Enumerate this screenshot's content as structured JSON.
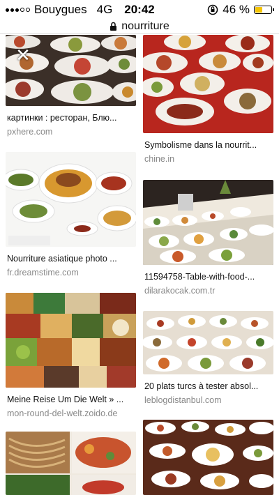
{
  "status": {
    "carrier": "Bouygues",
    "network": "4G",
    "time": "20:42",
    "battery": "46 %",
    "battery_level": 0.46
  },
  "url": {
    "text": "nourriture",
    "lock_icon": "lock-icon"
  },
  "colors": {
    "battery": "#f5c400",
    "source_text": "#888888"
  },
  "results": {
    "left": [
      {
        "title": "картинки : ресторан, Блю...",
        "source": "pxhere.com"
      },
      {
        "title": "Nourriture asiatique photo ...",
        "source": "fr.dreamstime.com"
      },
      {
        "title": "Meine Reise Um Die Welt » ...",
        "source": "mon-round-del-welt.zoido.de"
      },
      {
        "title": "",
        "source": ""
      }
    ],
    "right": [
      {
        "title": "Symbolisme dans la nourrit...",
        "source": "chine.in"
      },
      {
        "title": "11594758-Table-with-food-...",
        "source": "dilarakocak.com.tr"
      },
      {
        "title": "20 plats turcs à tester absol...",
        "source": "leblogdistanbul.com"
      },
      {
        "title": "",
        "source": ""
      }
    ]
  },
  "close_label": "✕"
}
